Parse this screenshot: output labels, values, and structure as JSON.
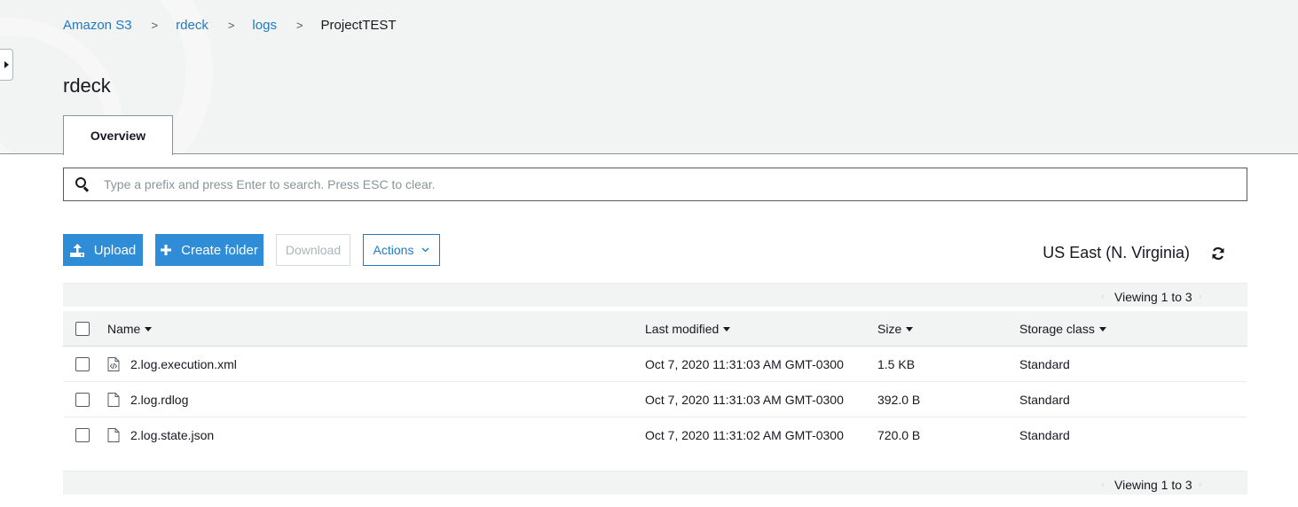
{
  "breadcrumb": {
    "items": [
      "Amazon S3",
      "rdeck",
      "logs"
    ],
    "current": "ProjectTEST",
    "separator": ">"
  },
  "page_title": "rdeck",
  "tabs": [
    {
      "label": "Overview",
      "active": true
    }
  ],
  "search": {
    "placeholder": "Type a prefix and press Enter to search. Press ESC to clear.",
    "value": ""
  },
  "toolbar": {
    "upload_label": "Upload",
    "create_folder_label": "Create folder",
    "download_label": "Download",
    "actions_label": "Actions"
  },
  "region": "US East (N. Virginia)",
  "pager": {
    "text": "Viewing 1 to 3"
  },
  "table": {
    "columns": [
      "Name",
      "Last modified",
      "Size",
      "Storage class"
    ],
    "rows": [
      {
        "name": "2.log.execution.xml",
        "icon": "code-file-icon",
        "modified": "Oct 7, 2020 11:31:03 AM GMT-0300",
        "size": "1.5 KB",
        "storage_class": "Standard"
      },
      {
        "name": "2.log.rdlog",
        "icon": "file-icon",
        "modified": "Oct 7, 2020 11:31:03 AM GMT-0300",
        "size": "392.0 B",
        "storage_class": "Standard"
      },
      {
        "name": "2.log.state.json",
        "icon": "file-icon",
        "modified": "Oct 7, 2020 11:31:02 AM GMT-0300",
        "size": "720.0 B",
        "storage_class": "Standard"
      }
    ]
  },
  "colors": {
    "link": "#1f7bc0",
    "primary_button": "#2e8dd6",
    "header_bg": "#f2f3f3"
  }
}
